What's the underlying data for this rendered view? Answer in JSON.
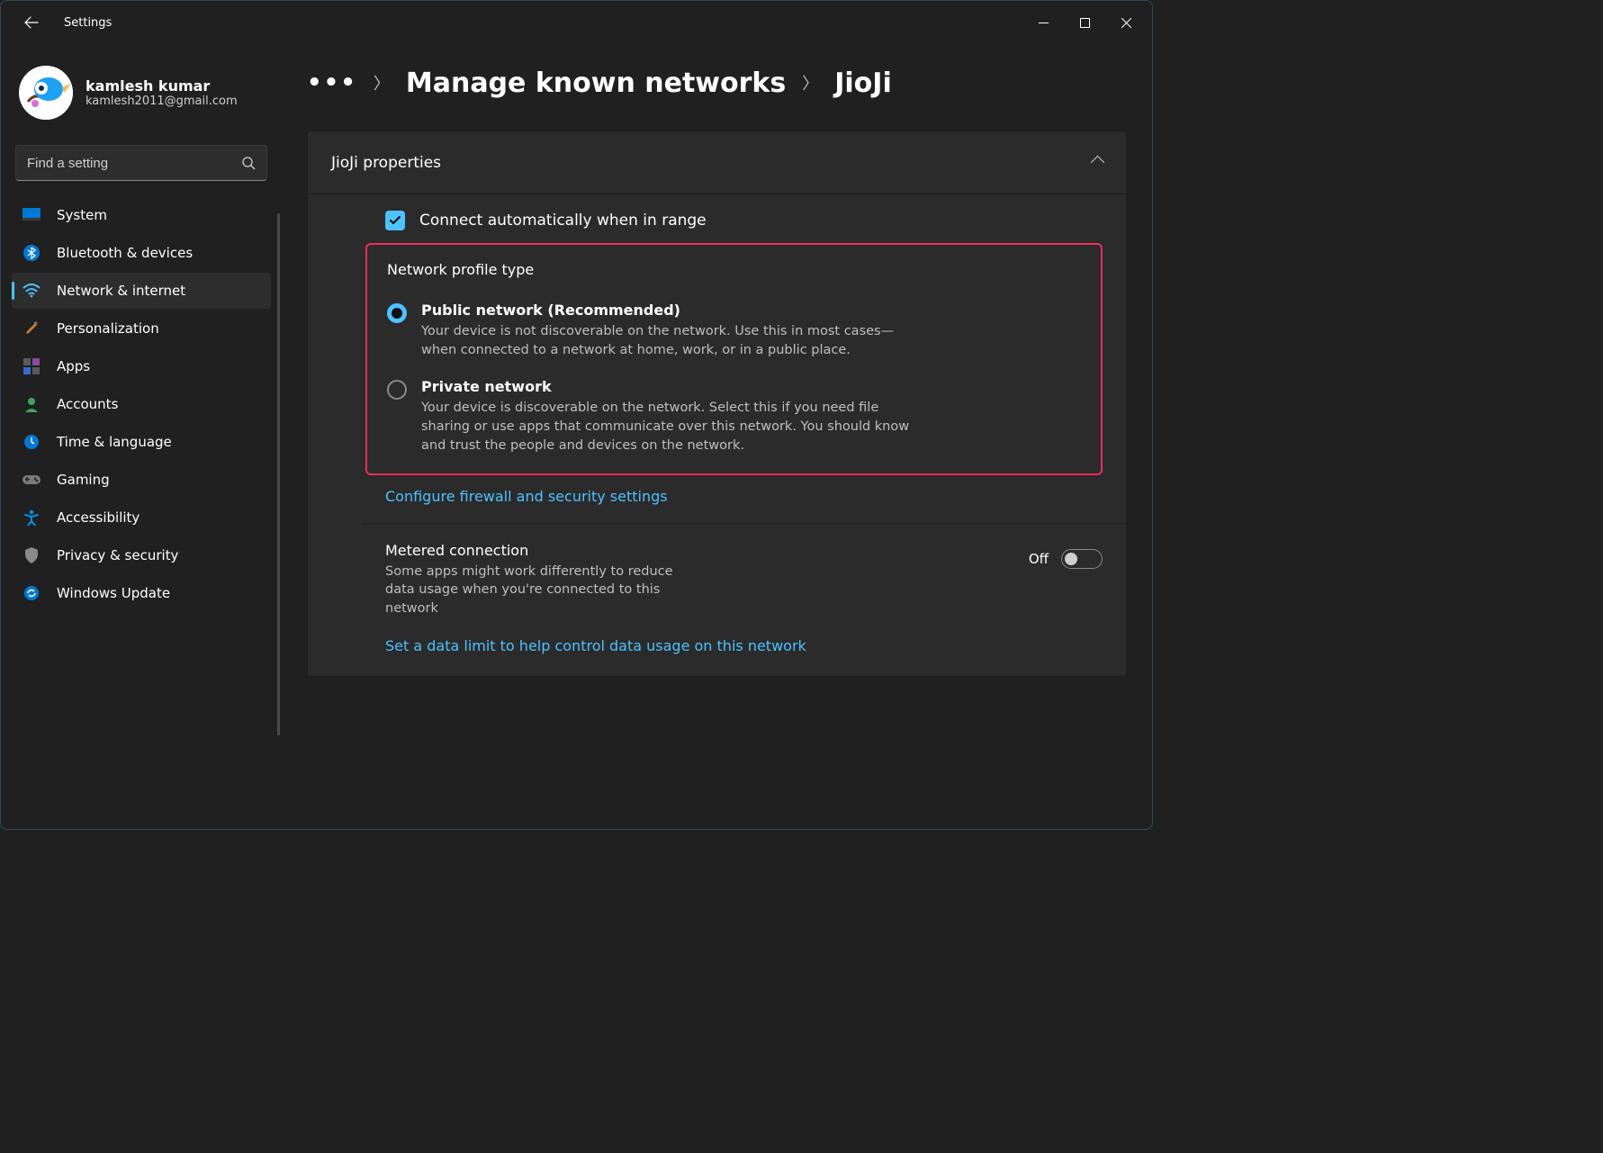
{
  "titlebar": {
    "app_title": "Settings"
  },
  "profile": {
    "name": "kamlesh kumar",
    "email": "kamlesh2011@gmail.com"
  },
  "search": {
    "placeholder": "Find a setting"
  },
  "nav": {
    "items": [
      {
        "label": "System"
      },
      {
        "label": "Bluetooth & devices"
      },
      {
        "label": "Network & internet"
      },
      {
        "label": "Personalization"
      },
      {
        "label": "Apps"
      },
      {
        "label": "Accounts"
      },
      {
        "label": "Time & language"
      },
      {
        "label": "Gaming"
      },
      {
        "label": "Accessibility"
      },
      {
        "label": "Privacy & security"
      },
      {
        "label": "Windows Update"
      }
    ]
  },
  "breadcrumb": {
    "parent": "Manage known networks",
    "current": "JioJi"
  },
  "panel": {
    "header": "JioJi properties",
    "auto_label": "Connect automatically when in range",
    "profile_type_title": "Network profile type",
    "public": {
      "title": "Public network (Recommended)",
      "desc": "Your device is not discoverable on the network. Use this in most cases—when connected to a network at home, work, or in a public place."
    },
    "private": {
      "title": "Private network",
      "desc": "Your device is discoverable on the network. Select this if you need file sharing or use apps that communicate over this network. You should know and trust the people and devices on the network."
    },
    "firewall_link": "Configure firewall and security settings",
    "metered": {
      "title": "Metered connection",
      "desc": "Some apps might work differently to reduce data usage when you're connected to this network",
      "state_label": "Off"
    },
    "data_limit_link": "Set a data limit to help control data usage on this network"
  }
}
